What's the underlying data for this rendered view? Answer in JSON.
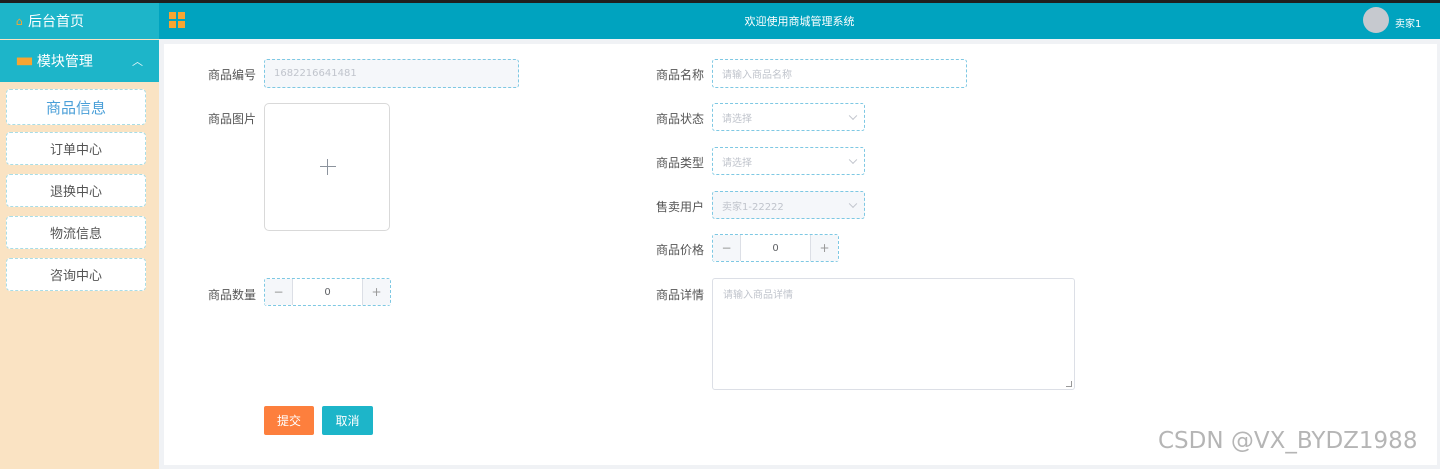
{
  "sidebar": {
    "home_label": "后台首页",
    "module_label": "模块管理",
    "items": [
      {
        "label": "商品信息",
        "active": true
      },
      {
        "label": "订单中心"
      },
      {
        "label": "退换中心"
      },
      {
        "label": "物流信息"
      },
      {
        "label": "咨询中心"
      }
    ]
  },
  "header": {
    "title": "欢迎使用商城管理系统",
    "username": "卖家1"
  },
  "form": {
    "product_no": {
      "label": "商品编号",
      "value": "1682216641481"
    },
    "product_name": {
      "label": "商品名称",
      "placeholder": "请输入商品名称"
    },
    "product_image": {
      "label": "商品图片"
    },
    "product_status": {
      "label": "商品状态",
      "placeholder": "请选择"
    },
    "product_type": {
      "label": "商品类型",
      "placeholder": "请选择"
    },
    "seller": {
      "label": "售卖用户",
      "value": "卖家1-22222"
    },
    "price": {
      "label": "商品价格",
      "value": "0"
    },
    "quantity": {
      "label": "商品数量",
      "value": "0"
    },
    "details": {
      "label": "商品详情",
      "placeholder": "请输入商品详情"
    }
  },
  "buttons": {
    "submit": "提交",
    "cancel": "取消"
  },
  "stepper_symbols": {
    "minus": "−",
    "plus": "+"
  },
  "watermark": "CSDN @VX_BYDZ1988",
  "colors": {
    "header": "#00a3bf",
    "sidebar_accent": "#1db5c9",
    "sidebar_bg": "#fae3c3",
    "submit": "#fd7f3d",
    "cancel": "#1db5c9"
  }
}
